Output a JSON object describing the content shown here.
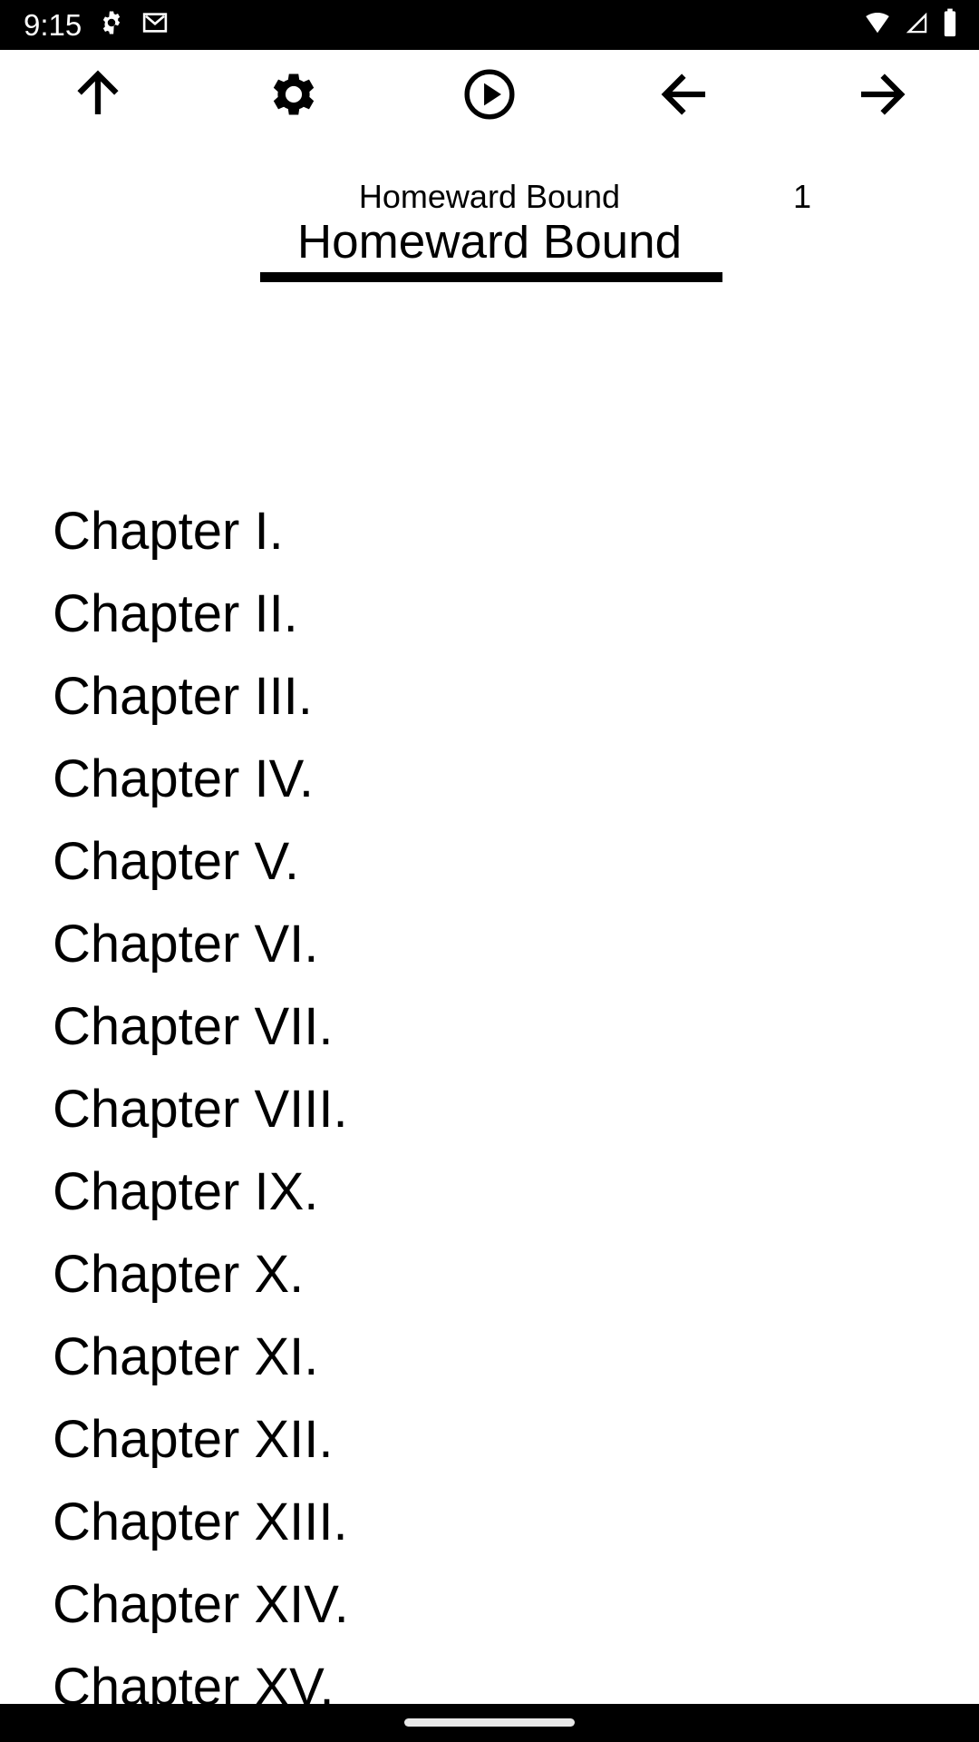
{
  "status_bar": {
    "time": "9:15",
    "icons_left": [
      "gear-icon",
      "gmail-icon"
    ],
    "icons_right": [
      "wifi-icon",
      "cell-signal-icon",
      "battery-icon"
    ],
    "background": "#000000",
    "foreground": "#ffffff"
  },
  "toolbar": {
    "buttons": [
      {
        "name": "up-arrow-icon",
        "label": "Up"
      },
      {
        "name": "gear-icon",
        "label": "Settings"
      },
      {
        "name": "play-circle-icon",
        "label": "Play"
      },
      {
        "name": "left-arrow-icon",
        "label": "Previous"
      },
      {
        "name": "right-arrow-icon",
        "label": "Next"
      }
    ]
  },
  "header": {
    "book_name": "Homeward Bound",
    "page_number": "1",
    "title": "Homeward Bound",
    "rule_color": "#000000"
  },
  "toc": {
    "items": [
      {
        "label": "Chapter I."
      },
      {
        "label": "Chapter II."
      },
      {
        "label": "Chapter III."
      },
      {
        "label": "Chapter IV."
      },
      {
        "label": "Chapter V."
      },
      {
        "label": "Chapter VI."
      },
      {
        "label": "Chapter VII."
      },
      {
        "label": "Chapter VIII."
      },
      {
        "label": "Chapter IX."
      },
      {
        "label": "Chapter X."
      },
      {
        "label": "Chapter XI."
      },
      {
        "label": "Chapter XII."
      },
      {
        "label": "Chapter XIII."
      },
      {
        "label": "Chapter XIV."
      },
      {
        "label": "Chapter XV."
      }
    ]
  },
  "nav_bar": {
    "gesture_pill": "home-gesture-pill",
    "background": "#000000",
    "pill_color": "#e8e8e8"
  }
}
